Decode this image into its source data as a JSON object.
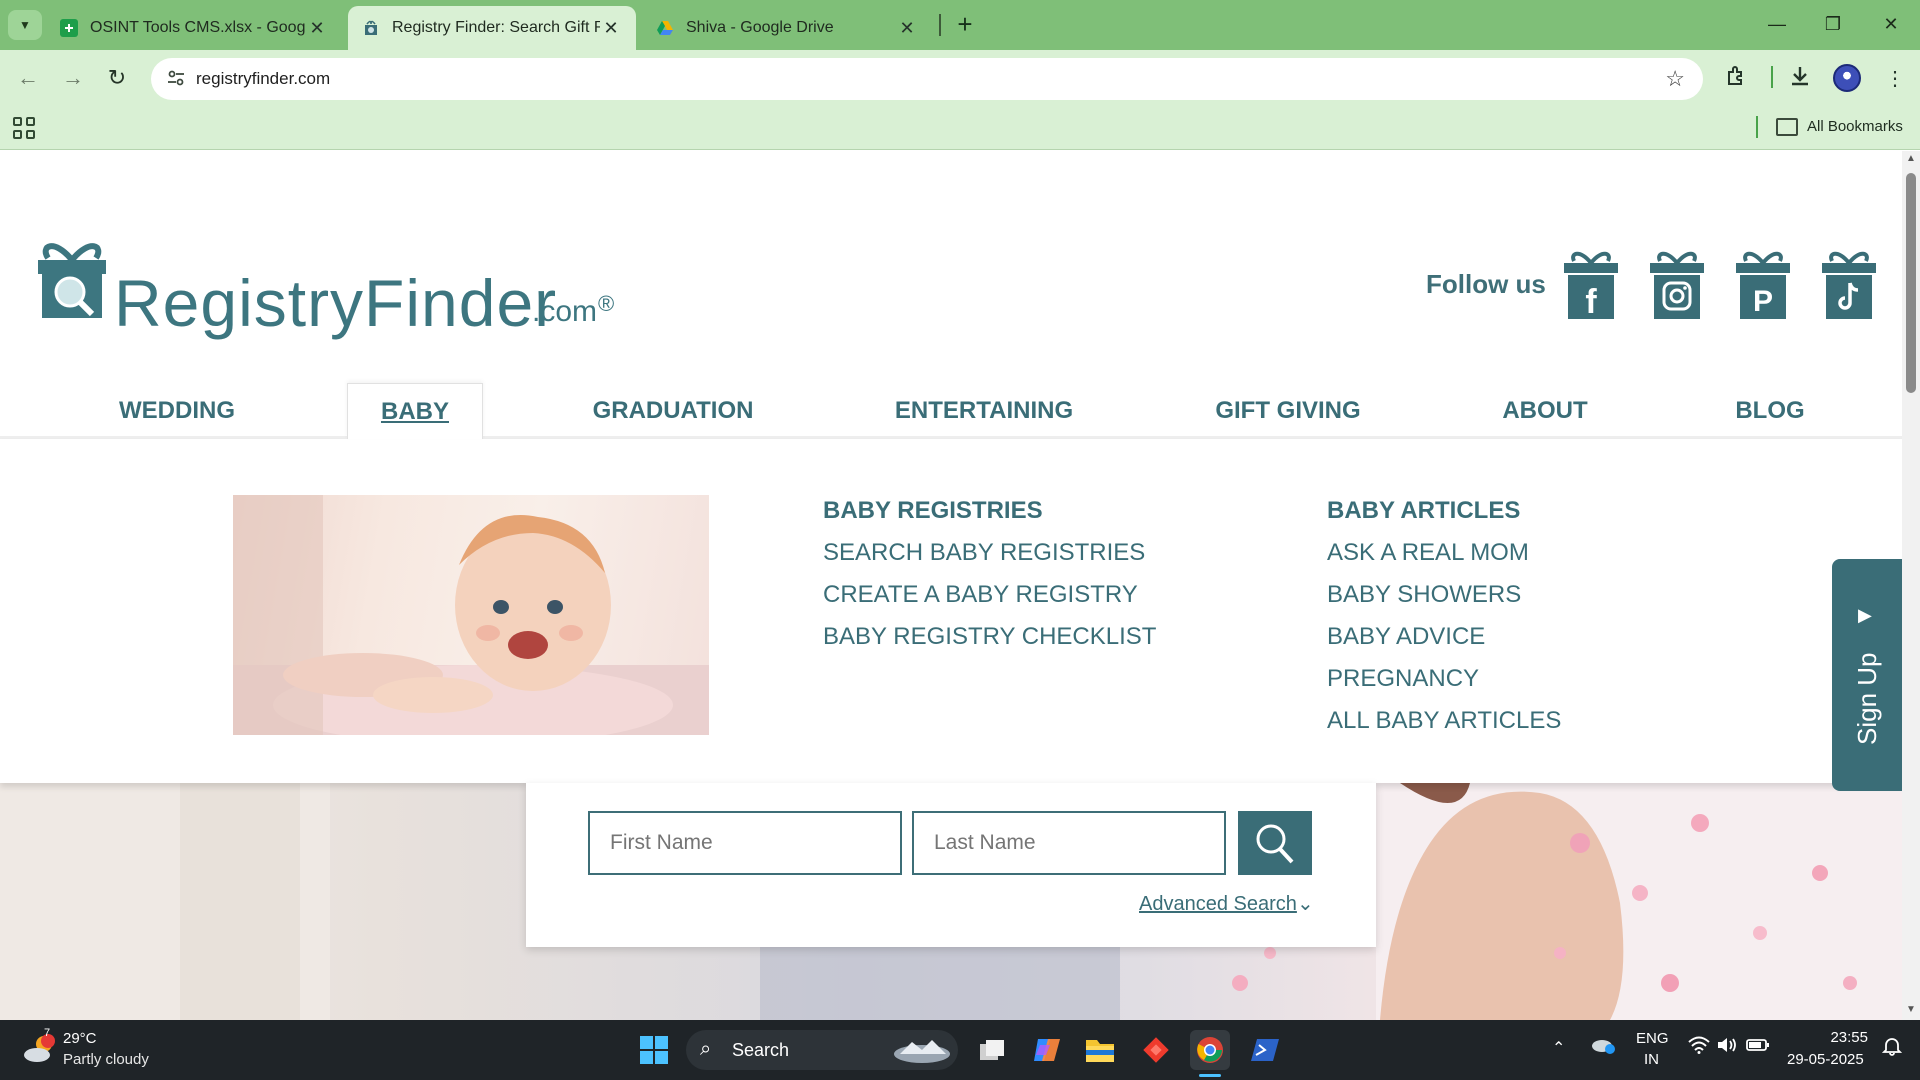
{
  "browser": {
    "tabs": [
      {
        "title": "OSINT Tools CMS.xlsx - Google",
        "icon": "sheets-icon",
        "active": false
      },
      {
        "title": "Registry Finder: Search Gift Reg",
        "icon": "registryfinder-icon",
        "active": true
      },
      {
        "title": "Shiva - Google Drive",
        "icon": "drive-icon",
        "active": false
      }
    ],
    "new_tab": "+",
    "url": "registryfinder.com",
    "bookmarks_label": "All Bookmarks"
  },
  "page": {
    "logo": {
      "word": "RegistryFinder",
      "com": ".com",
      "reg": "®"
    },
    "follow_us": "Follow us",
    "social": [
      "facebook-icon",
      "instagram-icon",
      "pinterest-icon",
      "tiktok-icon"
    ],
    "nav": [
      "WEDDING",
      "BABY",
      "GRADUATION",
      "ENTERTAINING",
      "GIFT GIVING",
      "ABOUT",
      "BLOG"
    ],
    "active_nav": "BABY",
    "menu": {
      "col1": {
        "heading": "BABY REGISTRIES",
        "links": [
          "SEARCH BABY REGISTRIES",
          "CREATE A BABY REGISTRY",
          "BABY REGISTRY CHECKLIST"
        ]
      },
      "col2": {
        "heading": "BABY ARTICLES",
        "links": [
          "ASK A REAL MOM",
          "BABY SHOWERS",
          "BABY ADVICE",
          "PREGNANCY",
          "ALL BABY ARTICLES"
        ]
      }
    },
    "search": {
      "first_placeholder": "First Name",
      "last_placeholder": "Last Name",
      "advanced": "Advanced Search"
    },
    "signup": "Sign Up"
  },
  "taskbar": {
    "weather_badge": "7",
    "temperature": "29°C",
    "weather_desc": "Partly cloudy",
    "search_label": "Search",
    "lang_top": "ENG",
    "lang_bottom": "IN",
    "time": "23:55",
    "date": "29-05-2025"
  },
  "colors": {
    "brand": "#3a6d77",
    "chrome_frame": "#7fbf78",
    "chrome_toolbar": "#d9f0d4",
    "taskbar": "#1f2428"
  }
}
